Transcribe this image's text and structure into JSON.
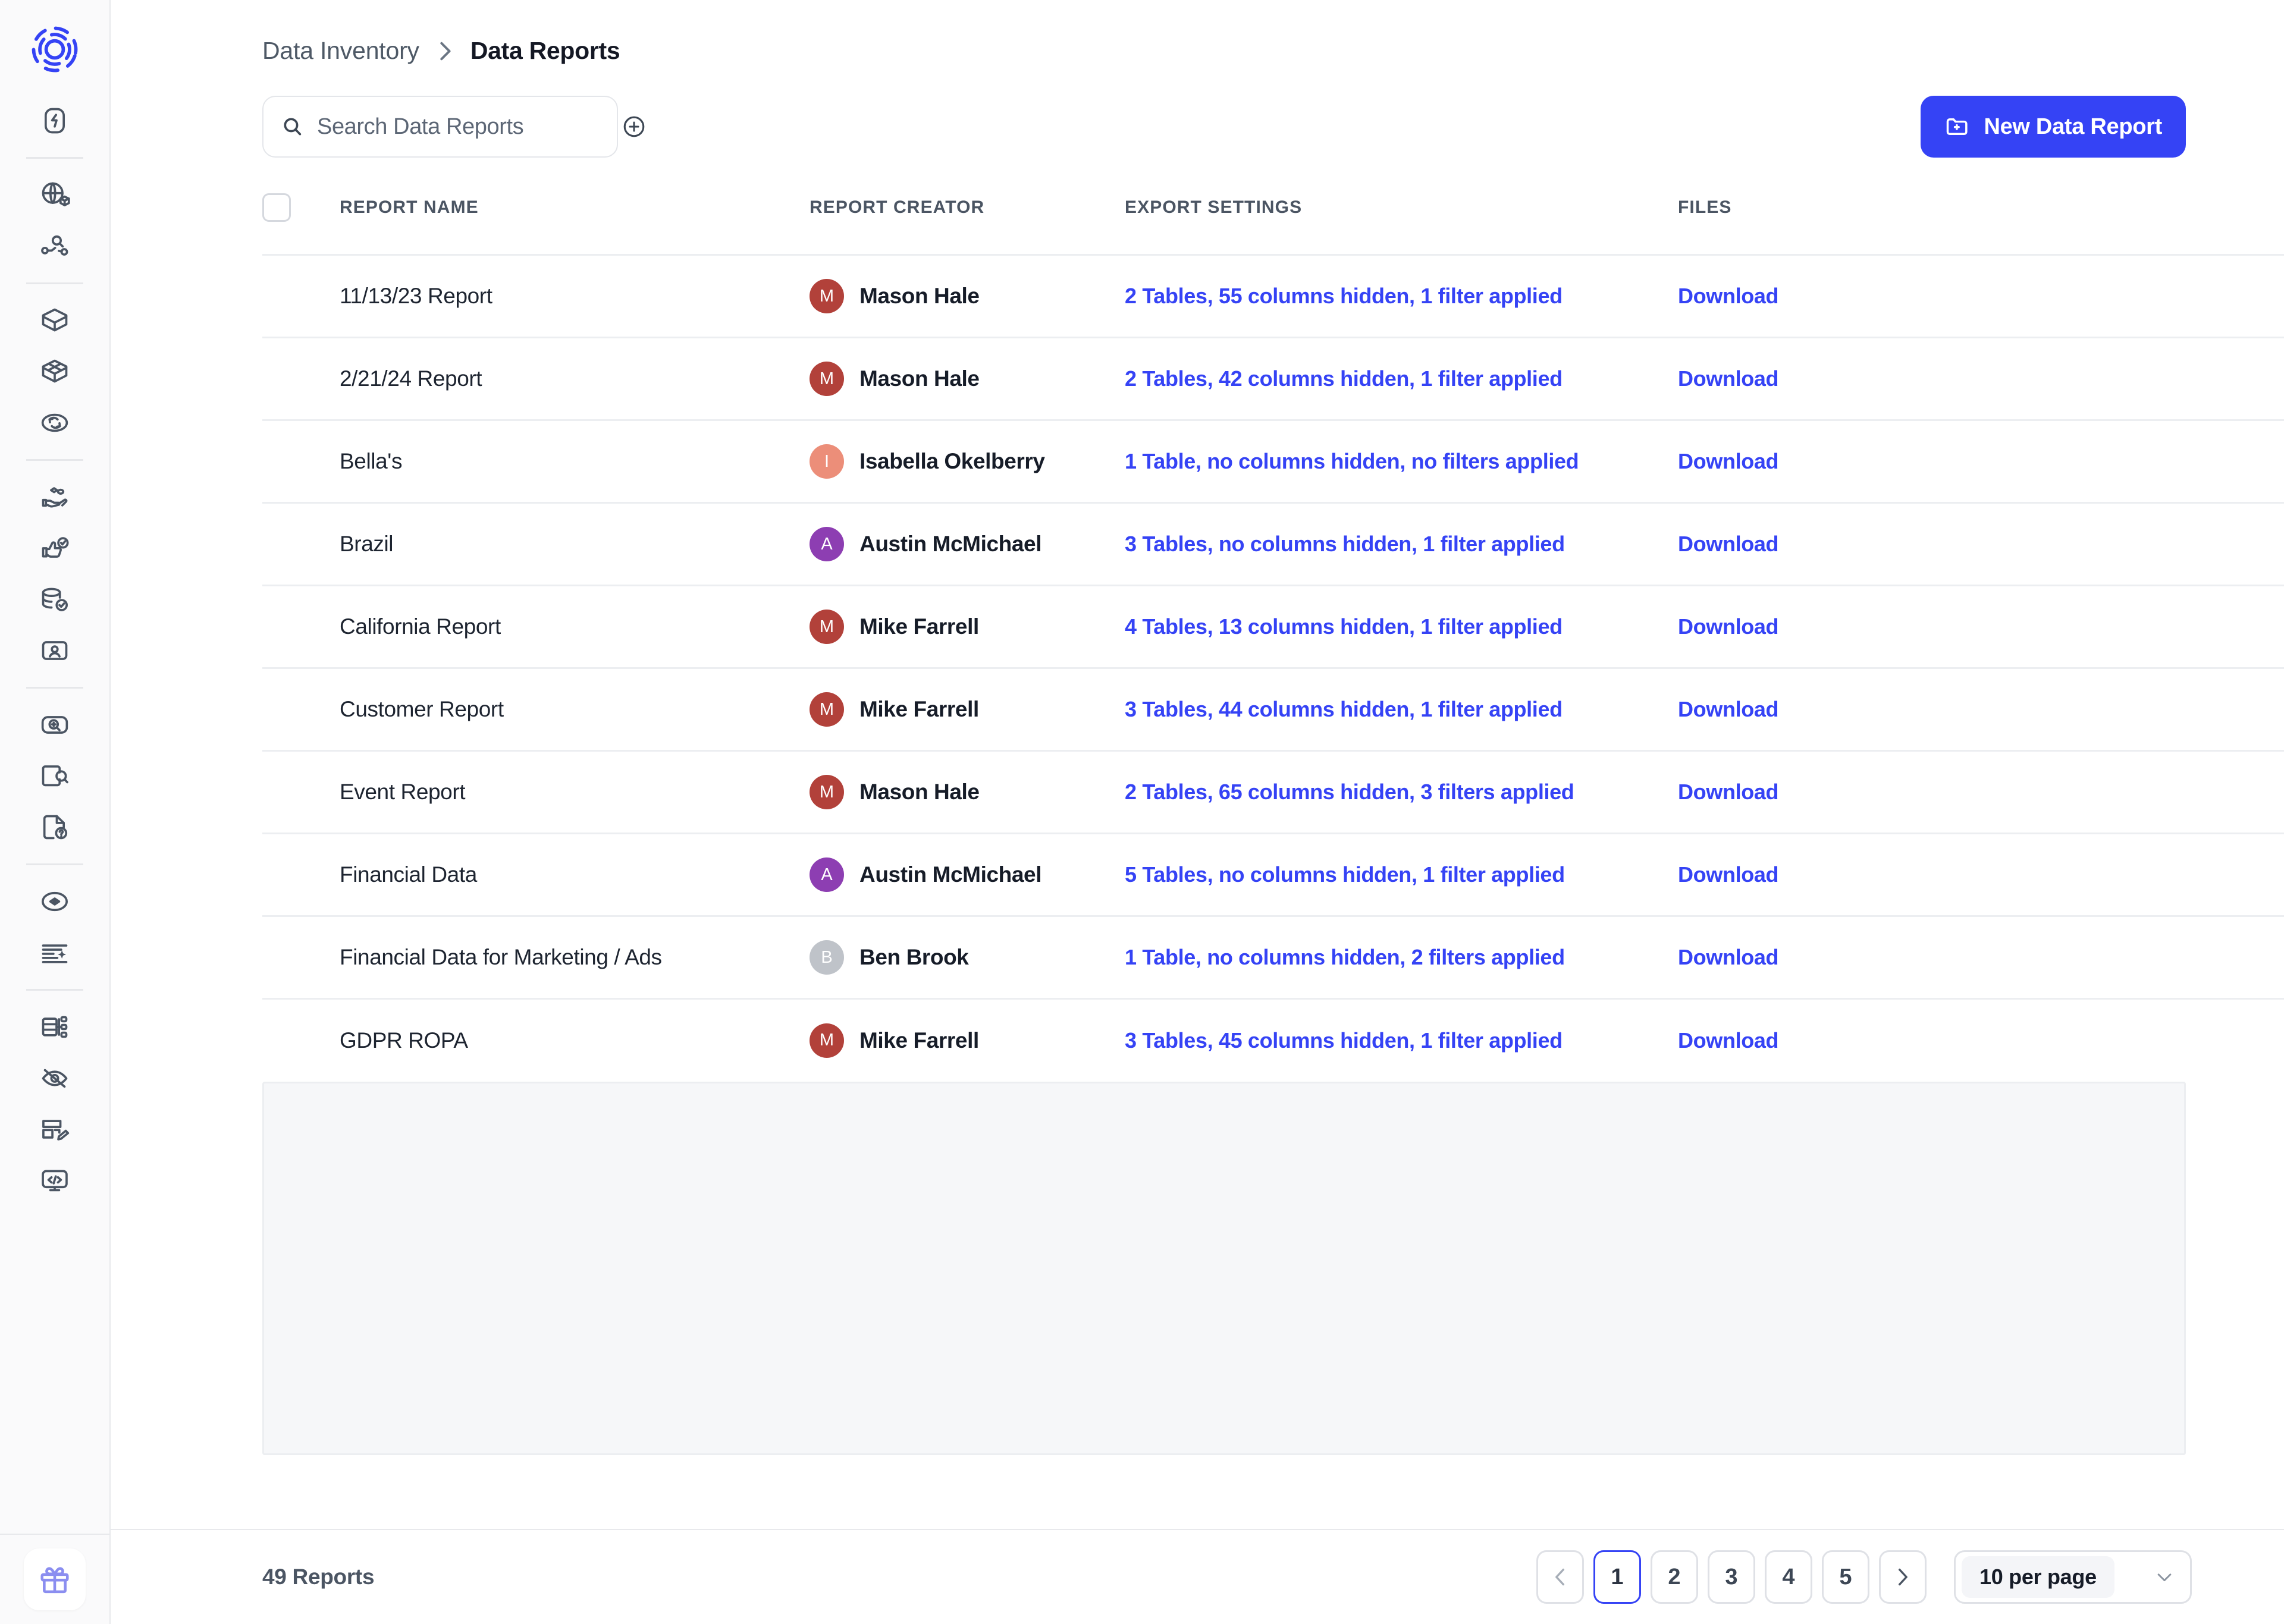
{
  "app": {
    "logo_icon": "concentric-dashed-rings-logo",
    "brand_color": "#3543f5"
  },
  "sidebar": {
    "items": [
      {
        "icon": "lightning-bolt-rounded-icon",
        "name": "sidebar-item-actions"
      },
      {
        "icon": "globe-box-icon",
        "name": "sidebar-item-data-mapping"
      },
      {
        "icon": "node-graph-search-icon",
        "name": "sidebar-item-data-lineage"
      },
      {
        "icon": "cube-icon",
        "name": "sidebar-item-data-silos"
      },
      {
        "icon": "stacked-cube-grid-icon",
        "name": "sidebar-item-data-inventory"
      },
      {
        "icon": "globe-arrows-icon",
        "name": "sidebar-item-data-flows"
      },
      {
        "icon": "hand-with-data-icon",
        "name": "sidebar-item-consent"
      },
      {
        "icon": "thumbs-up-check-icon",
        "name": "sidebar-item-preferences"
      },
      {
        "icon": "database-check-icon",
        "name": "sidebar-item-data-sources"
      },
      {
        "icon": "id-card-icon",
        "name": "sidebar-item-identifiers"
      },
      {
        "icon": "screen-search-plus-icon",
        "name": "sidebar-item-discovery"
      },
      {
        "icon": "window-search-icon",
        "name": "sidebar-item-scans"
      },
      {
        "icon": "file-question-icon",
        "name": "sidebar-item-requests"
      },
      {
        "icon": "compass-icon",
        "name": "sidebar-item-assessments"
      },
      {
        "icon": "text-sparkle-icon",
        "name": "sidebar-item-ai-summaries"
      },
      {
        "icon": "table-nodes-icon",
        "name": "sidebar-item-data-reports"
      },
      {
        "icon": "eye-off-icon",
        "name": "sidebar-item-masking"
      },
      {
        "icon": "layout-edit-icon",
        "name": "sidebar-item-templates"
      },
      {
        "icon": "monitor-code-icon",
        "name": "sidebar-item-developer"
      }
    ],
    "gift_icon": "gift-icon"
  },
  "breadcrumb": {
    "parent": "Data Inventory",
    "separator_icon": "chevron-right-icon",
    "current": "Data Reports"
  },
  "toolbar": {
    "search": {
      "icon": "search-icon",
      "placeholder": "Search Data Reports",
      "value": "",
      "add_icon": "plus-circle-icon"
    },
    "new_report_button": {
      "icon": "folder-plus-icon",
      "label": "New Data Report"
    }
  },
  "table": {
    "headers": {
      "select_all": "",
      "name": "REPORT NAME",
      "creator": "REPORT CREATOR",
      "export": "EXPORT SETTINGS",
      "files": "FILES"
    },
    "rows": [
      {
        "name": "11/13/23 Report",
        "creator": "Mason Hale",
        "initial": "M",
        "avatar_color": "#b2413a",
        "export": "2 Tables, 55 columns hidden, 1 filter applied",
        "file_action": "Download"
      },
      {
        "name": "2/21/24 Report",
        "creator": "Mason Hale",
        "initial": "M",
        "avatar_color": "#b2413a",
        "export": "2 Tables, 42 columns hidden, 1 filter applied",
        "file_action": "Download"
      },
      {
        "name": "Bella's",
        "creator": "Isabella Okelberry",
        "initial": "I",
        "avatar_color": "#ec8e79",
        "export": "1 Table, no columns hidden, no filters applied",
        "file_action": "Download"
      },
      {
        "name": "Brazil",
        "creator": "Austin McMichael",
        "initial": "A",
        "avatar_color": "#8d3eb2",
        "export": "3 Tables, no columns hidden, 1 filter applied",
        "file_action": "Download"
      },
      {
        "name": "California Report",
        "creator": "Mike Farrell",
        "initial": "M",
        "avatar_color": "#b2413a",
        "export": "4 Tables, 13 columns hidden, 1 filter applied",
        "file_action": "Download"
      },
      {
        "name": "Customer Report",
        "creator": "Mike Farrell",
        "initial": "M",
        "avatar_color": "#b2413a",
        "export": "3 Tables, 44 columns hidden, 1 filter applied",
        "file_action": "Download"
      },
      {
        "name": "Event Report",
        "creator": "Mason Hale",
        "initial": "M",
        "avatar_color": "#b2413a",
        "export": "2 Tables, 65 columns hidden, 3 filters applied",
        "file_action": "Download"
      },
      {
        "name": "Financial Data",
        "creator": "Austin McMichael",
        "initial": "A",
        "avatar_color": "#8d3eb2",
        "export": "5 Tables, no columns hidden, 1 filter applied",
        "file_action": "Download"
      },
      {
        "name": "Financial Data for Marketing / Ads",
        "creator": "Ben Brook",
        "initial": "B",
        "avatar_color": "#bfc3c9",
        "export": "1 Table, no columns hidden, 2 filters applied",
        "file_action": "Download"
      },
      {
        "name": "GDPR ROPA",
        "creator": "Mike Farrell",
        "initial": "M",
        "avatar_color": "#b2413a",
        "export": "3 Tables, 45 columns hidden, 1 filter applied",
        "file_action": "Download"
      }
    ]
  },
  "footer": {
    "count_label": "49 Reports",
    "pagination": {
      "prev_icon": "chevron-left-icon",
      "next_icon": "chevron-right-icon",
      "pages": [
        "1",
        "2",
        "3",
        "4",
        "5"
      ],
      "active_page": "1",
      "per_page_value": "10 per page",
      "per_page_chevron": "chevron-down-icon"
    }
  }
}
